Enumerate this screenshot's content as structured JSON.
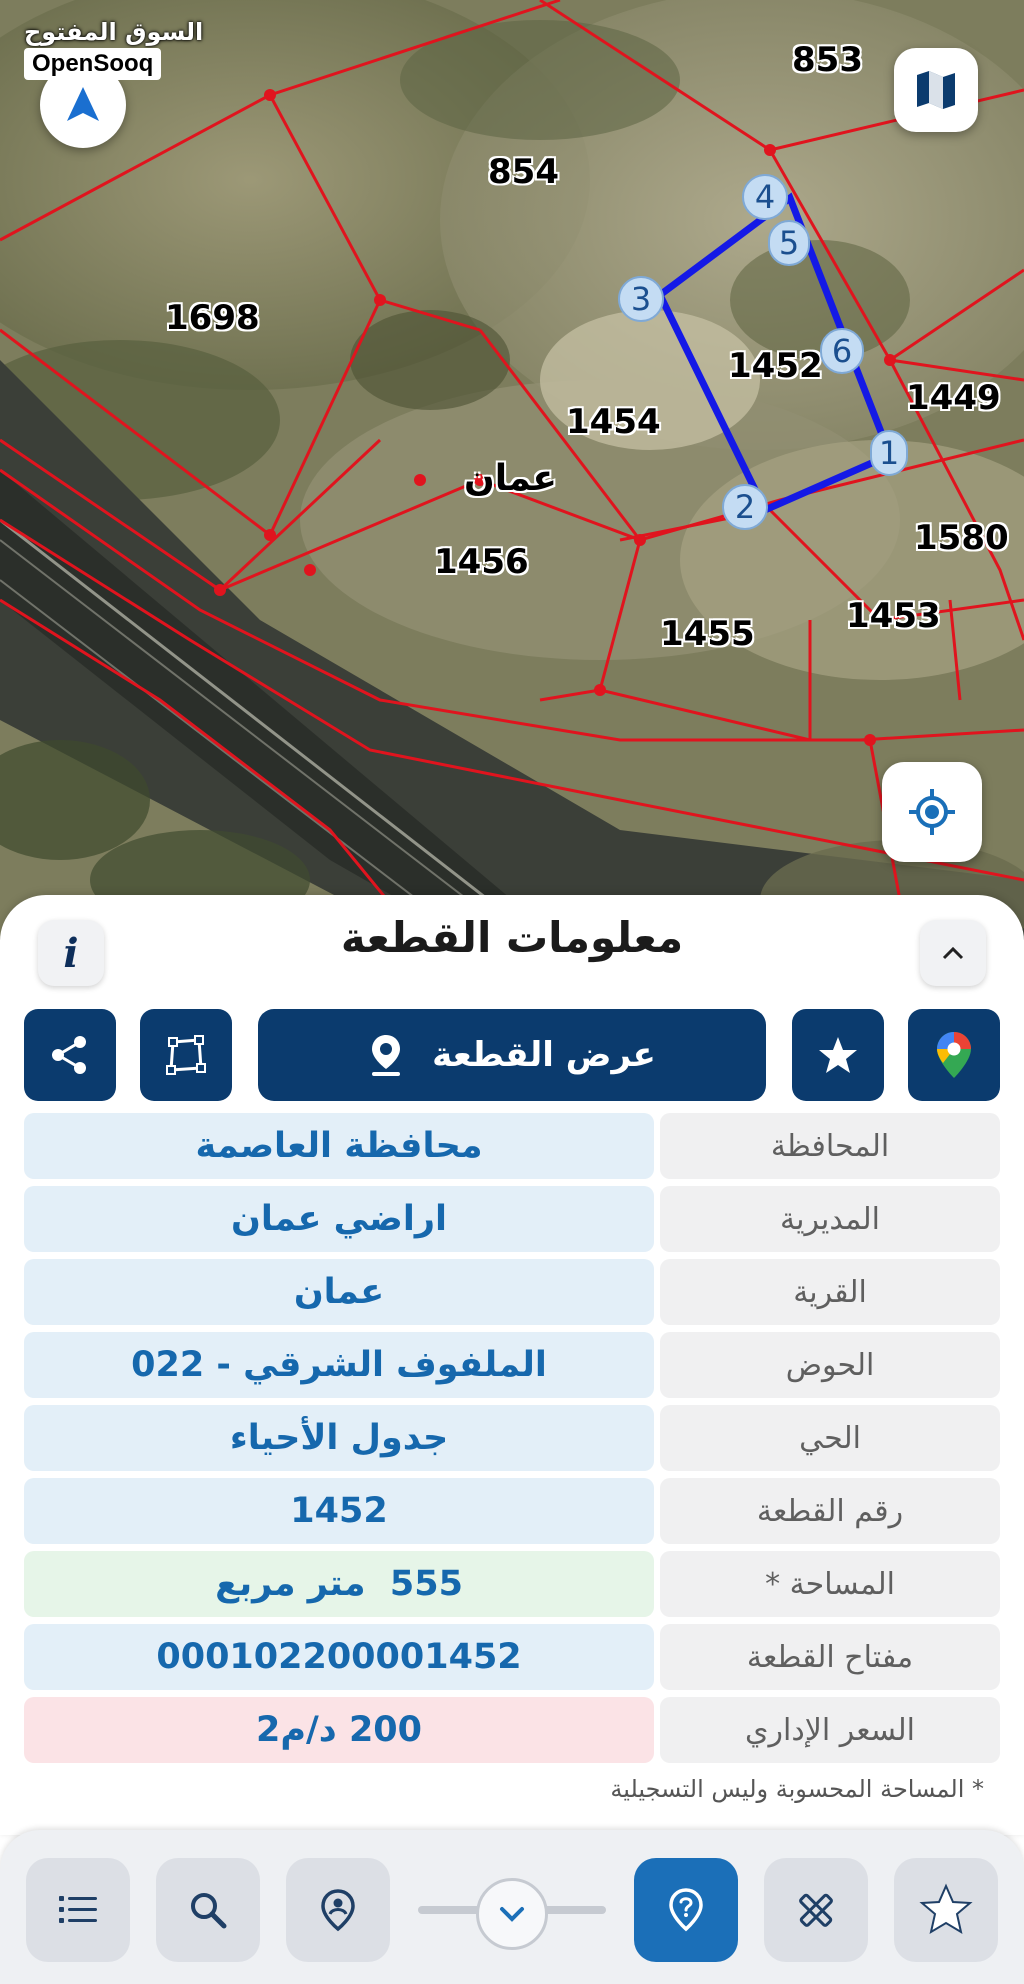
{
  "watermark": {
    "arabic": "السوق المفتوح",
    "brand": "OpenSooq"
  },
  "map": {
    "parcels": [
      {
        "id": "p853",
        "label": "853"
      },
      {
        "id": "p854",
        "label": "854"
      },
      {
        "id": "p1698",
        "label": "1698"
      },
      {
        "id": "p1452",
        "label": "1452"
      },
      {
        "id": "p1449",
        "label": "1449"
      },
      {
        "id": "p1454",
        "label": "1454"
      },
      {
        "id": "p1580",
        "label": "1580"
      },
      {
        "id": "p1456",
        "label": "1456"
      },
      {
        "id": "p1453",
        "label": "1453"
      },
      {
        "id": "p1455",
        "label": "1455"
      }
    ],
    "city_label": "عمان",
    "vertices": [
      "1",
      "2",
      "3",
      "4",
      "5",
      "6"
    ],
    "colors": {
      "boundary": "#e0141e",
      "selected": "#1419e6",
      "vertex": "#c4dcf3",
      "vertex_text": "#1b4f8f"
    }
  },
  "panel": {
    "title": "معلومات القطعة",
    "info_label": "i",
    "view_button": "عرض القطعة",
    "rows": [
      {
        "label": "المحافظة",
        "value": "محافظة العاصمة",
        "tone": "blue"
      },
      {
        "label": "المديرية",
        "value": "اراضي عمان",
        "tone": "blue"
      },
      {
        "label": "القرية",
        "value": "عمان",
        "tone": "blue"
      },
      {
        "label": "الحوض",
        "value": "الملفوف الشرقي - 022",
        "tone": "blue"
      },
      {
        "label": "الحي",
        "value": "جدول الأحياء",
        "tone": "blue"
      },
      {
        "label": "رقم القطعة",
        "value": "1452",
        "tone": "blue"
      },
      {
        "label": "المساحة *",
        "value": "555  متر مربع",
        "tone": "green"
      },
      {
        "label": "مفتاح القطعة",
        "value": "000102200001452",
        "tone": "blue"
      },
      {
        "label": "السعر الإداري",
        "value": "200 د/م2",
        "tone": "red"
      }
    ],
    "footnote": "* المساحة المحسوبة وليس التسجيلية"
  },
  "colors": {
    "primary": "#0b3b6e",
    "accent": "#1b6fb8",
    "value_text": "#1668ad"
  }
}
